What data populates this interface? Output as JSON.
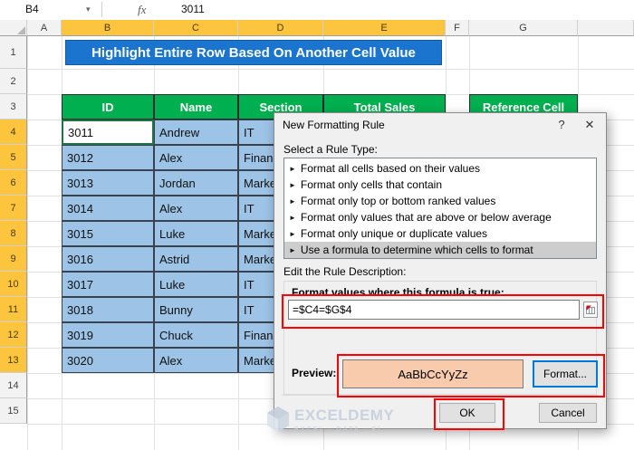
{
  "app": {
    "name_box": "B4",
    "fx_label": "fx",
    "formula_value": "3011",
    "column_headers": [
      "A",
      "B",
      "C",
      "D",
      "E",
      "F",
      "G"
    ],
    "row_headers": [
      "1",
      "2",
      "3",
      "4",
      "5",
      "6",
      "7",
      "8",
      "9",
      "10",
      "11",
      "12",
      "13",
      "14",
      "15"
    ],
    "selected_columns": [
      "B",
      "C",
      "D",
      "E"
    ],
    "selected_rows": [
      "4",
      "5",
      "6",
      "7",
      "8",
      "9",
      "10",
      "11",
      "12",
      "13"
    ]
  },
  "sheet": {
    "title_banner": "Highlight Entire Row Based On Another Cell Value",
    "table_headers": {
      "id": "ID",
      "name": "Name",
      "section": "Section",
      "total_sales": "Total Sales"
    },
    "reference_header": "Reference Cell",
    "rows": [
      {
        "id": "3011",
        "name": "Andrew",
        "section": "IT"
      },
      {
        "id": "3012",
        "name": "Alex",
        "section": "Finance"
      },
      {
        "id": "3013",
        "name": "Jordan",
        "section": "Marketing"
      },
      {
        "id": "3014",
        "name": "Alex",
        "section": "IT"
      },
      {
        "id": "3015",
        "name": "Luke",
        "section": "Marketing"
      },
      {
        "id": "3016",
        "name": "Astrid",
        "section": "Marketing"
      },
      {
        "id": "3017",
        "name": "Luke",
        "section": "IT"
      },
      {
        "id": "3018",
        "name": "Bunny",
        "section": "IT"
      },
      {
        "id": "3019",
        "name": "Chuck",
        "section": "Finance"
      },
      {
        "id": "3020",
        "name": "Alex",
        "section": "Marketing"
      }
    ]
  },
  "dialog": {
    "title": "New Formatting Rule",
    "help_glyph": "?",
    "close_glyph": "✕",
    "select_rule_label": "Select a Rule Type:",
    "rule_types": [
      "Format all cells based on their values",
      "Format only cells that contain",
      "Format only top or bottom ranked values",
      "Format only values that are above or below average",
      "Format only unique or duplicate values",
      "Use a formula to determine which cells to format"
    ],
    "selected_rule_index": 5,
    "edit_description_label": "Edit the Rule Description:",
    "formula_prompt": "Format values where this formula is true:",
    "formula_value": "=$C4=$G$4",
    "preview_label": "Preview:",
    "preview_sample": "AaBbCcYyZz",
    "format_button": "Format...",
    "ok_button": "OK",
    "cancel_button": "Cancel"
  },
  "icons": {
    "name_box_caret": "▾",
    "rule_arrow": "►"
  },
  "watermark": {
    "brand": "EXCELDEMY",
    "tagline": "EXCEL · DATA · BI"
  },
  "colors": {
    "banner_blue": "#1B74CE",
    "header_green": "#00B050",
    "table_blue": "#9DC3E6",
    "selected_header_gold": "#FCC53D",
    "preview_peach": "#F8CBAD",
    "annotation_red": "#FE0000",
    "focus_blue": "#0078D7"
  }
}
